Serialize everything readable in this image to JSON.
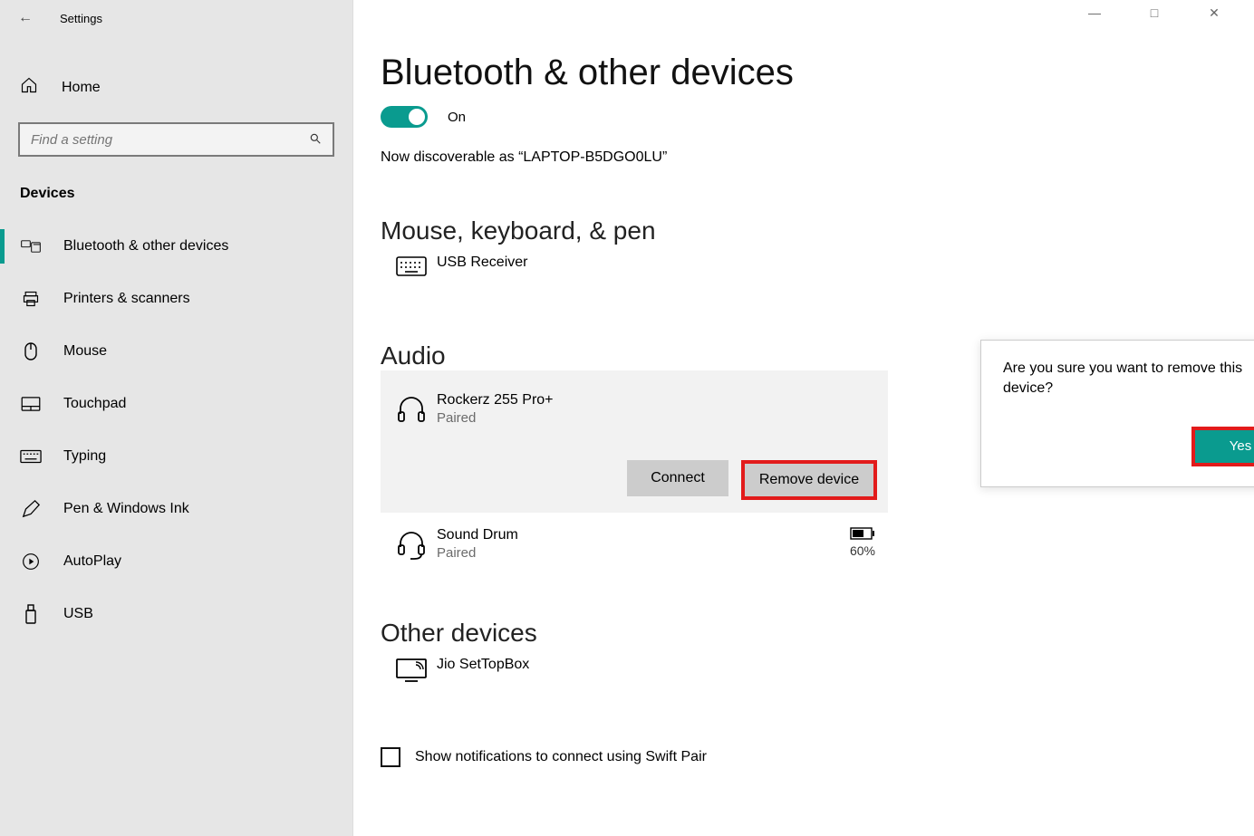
{
  "titlebar": {
    "title": "Settings"
  },
  "sidebar": {
    "home": "Home",
    "search_placeholder": "Find a setting",
    "section": "Devices",
    "items": [
      "Bluetooth & other devices",
      "Printers & scanners",
      "Mouse",
      "Touchpad",
      "Typing",
      "Pen & Windows Ink",
      "AutoPlay",
      "USB"
    ]
  },
  "main": {
    "title": "Bluetooth & other devices",
    "toggle_label": "On",
    "discoverable": "Now discoverable as “LAPTOP-B5DGO0LU”",
    "section_mouse": "Mouse, keyboard, & pen",
    "device_usb": "USB Receiver",
    "section_audio": "Audio",
    "device_rockerz": "Rockerz 255 Pro+",
    "paired": "Paired",
    "connect": "Connect",
    "remove": "Remove device",
    "device_sounddrum": "Sound Drum",
    "battery_pct": "60%",
    "section_other": "Other devices",
    "device_jio": "Jio SetTopBox",
    "swift_label": "Show notifications to connect using Swift Pair"
  },
  "popup": {
    "text": "Are you sure you want to remove this device?",
    "yes": "Yes"
  }
}
